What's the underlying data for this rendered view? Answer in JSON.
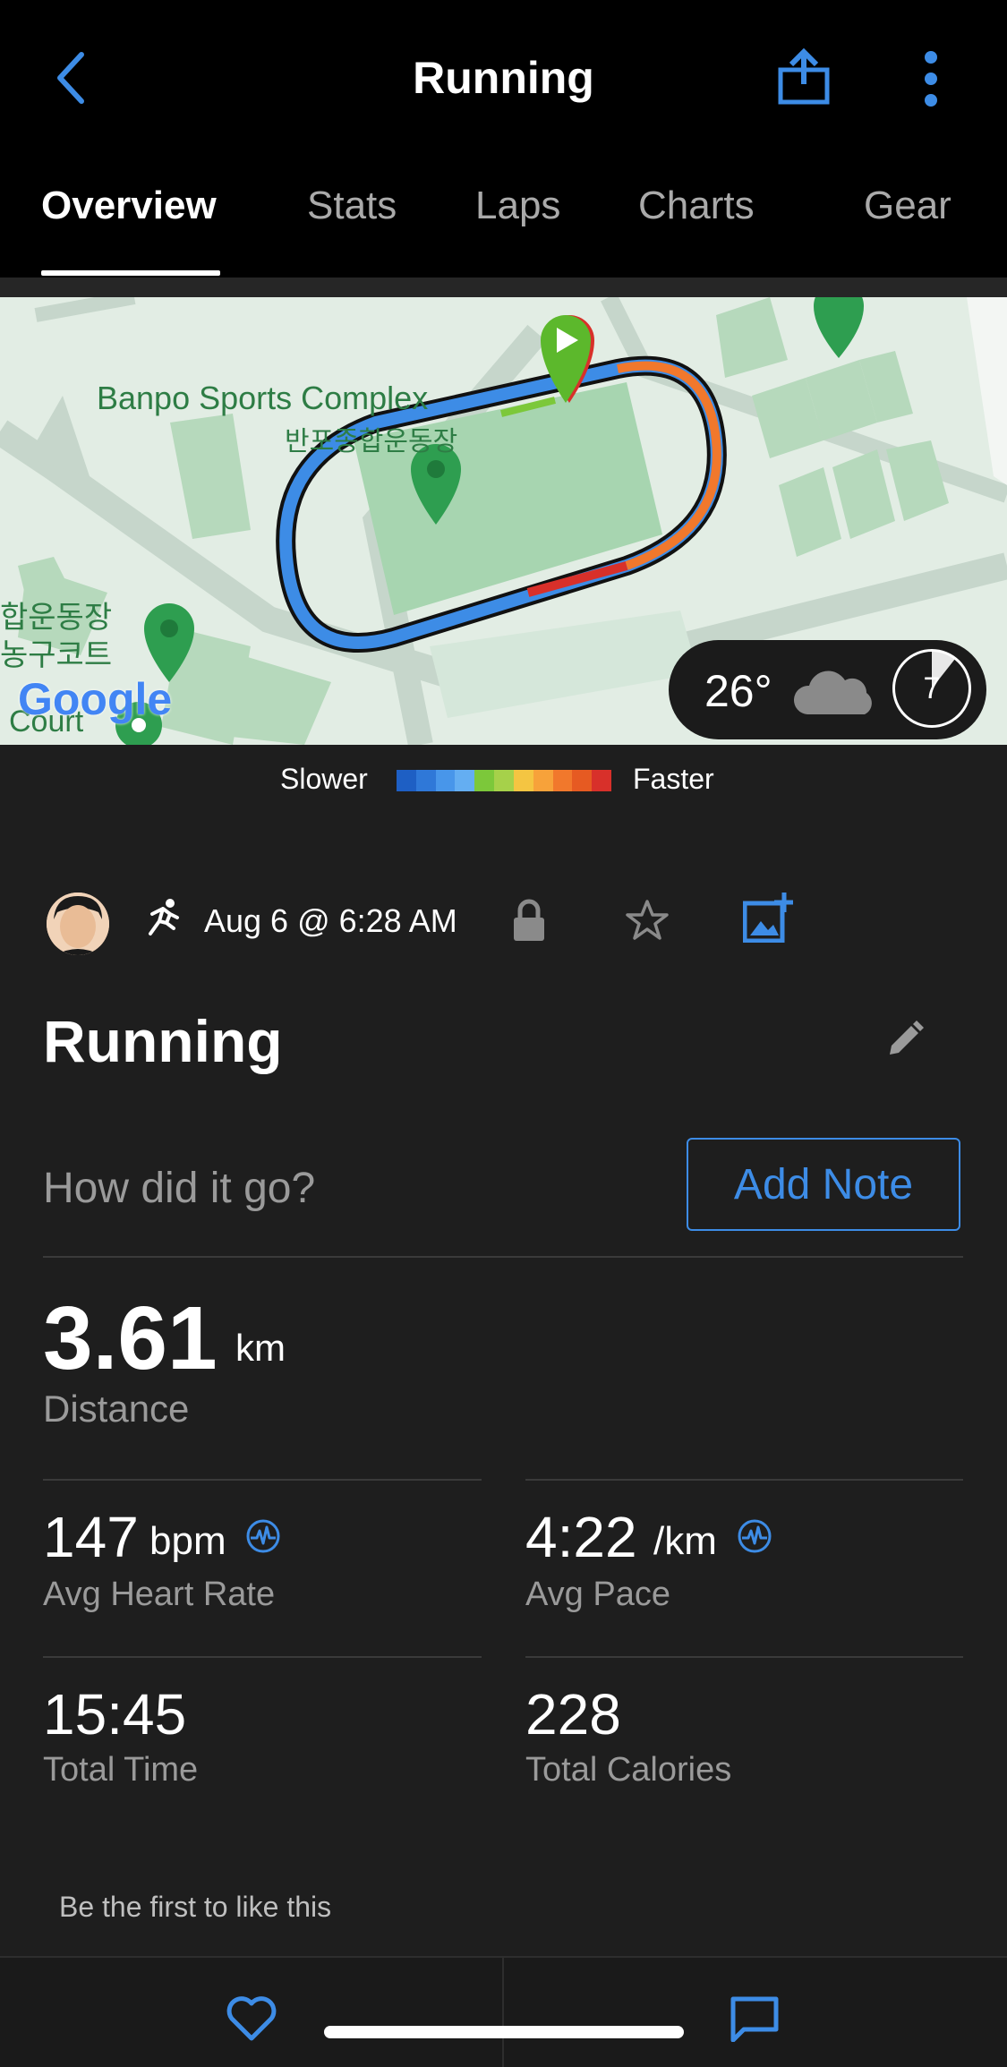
{
  "header": {
    "title": "Running",
    "tabs": [
      {
        "label": "Overview",
        "active": true
      },
      {
        "label": "Stats"
      },
      {
        "label": "Laps"
      },
      {
        "label": "Charts"
      },
      {
        "label": "Gear"
      }
    ]
  },
  "map": {
    "place_name_en": "Banpo Sports Complex",
    "place_name_kr": "반포종합운동장",
    "left_label_line1": "합운동장",
    "left_label_line2": "농구코트",
    "court_label": "Court",
    "attribution": "Google",
    "weather": {
      "temperature": "26°",
      "icon": "cloud-icon",
      "timer_value": "7"
    }
  },
  "legend": {
    "slower": "Slower",
    "faster": "Faster",
    "colors": [
      "#1e5fc4",
      "#2f78d8",
      "#4896ea",
      "#64aef2",
      "#7cc83a",
      "#a6d14a",
      "#f4c542",
      "#f7a23a",
      "#f1782c",
      "#e65a22",
      "#d8302a"
    ]
  },
  "meta": {
    "date": "Aug 6 @ 6:28 AM",
    "activity_icon": "running-icon"
  },
  "activity": {
    "name": "Running",
    "note_prompt": "How did it go?",
    "add_note_label": "Add Note"
  },
  "stats": {
    "distance": {
      "value": "3.61",
      "unit": "km",
      "label": "Distance"
    },
    "avg_hr": {
      "value": "147",
      "unit": "bpm",
      "label": "Avg Heart Rate"
    },
    "avg_pace": {
      "value": "4:22",
      "unit": "/km",
      "label": "Avg Pace"
    },
    "total_time": {
      "value": "15:45",
      "label": "Total Time"
    },
    "total_calories": {
      "value": "228",
      "label": "Total Calories"
    }
  },
  "social": {
    "likes_text": "Be the first to like this"
  },
  "colors": {
    "accent": "#3d8ce6",
    "background": "#1e1e1e",
    "header": "#000000"
  }
}
